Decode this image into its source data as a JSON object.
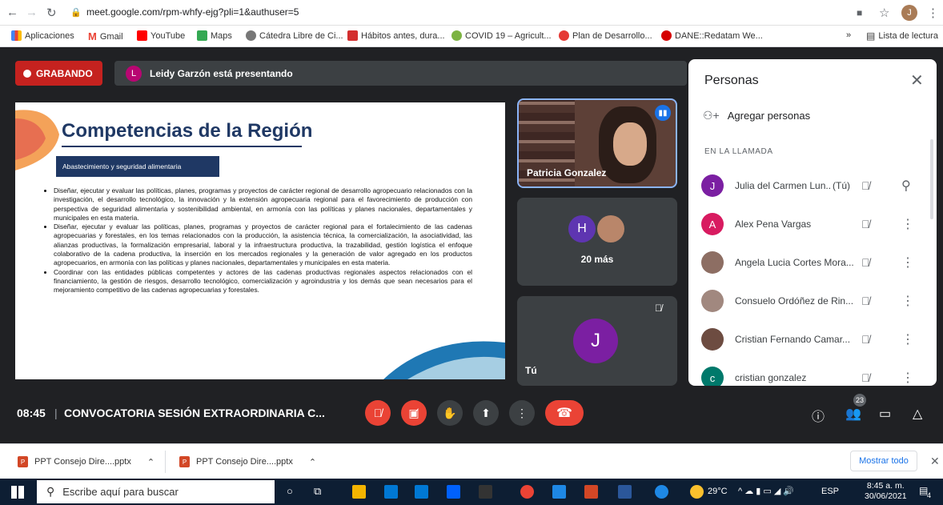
{
  "browser": {
    "url": "meet.google.com/rpm-whfy-ejg?pli=1&authuser=5",
    "profile_initial": "J",
    "bookmarks": [
      "Aplicaciones",
      "Gmail",
      "YouTube",
      "Maps",
      "Cátedra Libre de Ci...",
      "Hábitos antes, dura...",
      "COVID 19 – Agricult...",
      "Plan de Desarrollo...",
      "DANE::Redatam We..."
    ],
    "reading_list": "Lista de lectura"
  },
  "meet": {
    "recording_label": "GRABANDO",
    "presenter_initial": "L",
    "presenting_text": "Leidy Garzón está presentando",
    "slide": {
      "title": "Competencias de la Región",
      "subtitle": "Abastecimiento y seguridad alimentaria",
      "bullets": [
        "Diseñar, ejecutar y evaluar las políticas, planes, programas y proyectos de carácter regional de desarrollo agropecuario relacionados con la investigación, el desarrollo tecnológico, la innovación y la extensión agropecuaria regional para el favorecimiento de producción con perspectiva de seguridad alimentaria y sostenibilidad ambiental, en armonía con las políticas y planes nacionales, departamentales y municipales en esta materia.",
        "Diseñar, ejecutar y evaluar las políticas, planes, programas y proyectos de carácter regional para el fortalecimiento de las cadenas agropecuarias y forestales, en los temas relacionados con la producción, la asistencia técnica, la comercialización, la asociatividad, las alianzas productivas, la formalización empresarial, laboral y la infraestructura productiva, la trazabilidad, gestión logística el enfoque colaborativo de la cadena productiva, la inserción en los mercados regionales y la generación de valor agregado en los productos agropecuarios, en armonía con las políticas y planes nacionales, departamentales y municipales en esta materia.",
        "Coordinar con las entidades públicas competentes y actores de las cadenas productivas regionales aspectos relacionados con el financiamiento, la gestión de riesgos, desarrollo tecnológico, comercialización y agroindustria y los demás que sean necesarios para el mejoramiento competitivo de las cadenas agropecuarias y forestales."
      ]
    },
    "tiles": {
      "speaker_name": "Patricia Gonzalez",
      "more_label": "20 más",
      "more_initial": "H",
      "self_label": "Tú",
      "self_initial": "J"
    },
    "bottom": {
      "time": "08:45",
      "separator": "|",
      "title": "CONVOCATORIA SESIÓN EXTRAORDINARIA C...",
      "participants_count": "23"
    }
  },
  "panel": {
    "title": "Personas",
    "add_people": "Agregar personas",
    "section": "EN LA LLAMADA",
    "people": [
      {
        "initial": "J",
        "name": "Julia del Carmen Lun...",
        "suffix": "(Tú)",
        "color": "#7b1fa2"
      },
      {
        "initial": "A",
        "name": "Alex Pena Vargas",
        "suffix": "",
        "color": "#d81b60"
      },
      {
        "initial": "",
        "name": "Angela Lucia Cortes Mora...",
        "suffix": "",
        "color": "#8d6e63"
      },
      {
        "initial": "",
        "name": "Consuelo Ordóñez de Rin...",
        "suffix": "",
        "color": "#a1887f"
      },
      {
        "initial": "",
        "name": "Cristian Fernando Camar...",
        "suffix": "",
        "color": "#6d4c41"
      },
      {
        "initial": "c",
        "name": "cristian gonzalez",
        "suffix": "",
        "color": "#00796b"
      }
    ]
  },
  "downloads": {
    "files": [
      "PPT Consejo Dire....pptx",
      "PPT Consejo Dire....pptx"
    ],
    "show_all": "Mostrar todo"
  },
  "taskbar": {
    "search_placeholder": "Escribe aquí para buscar",
    "weather": "29°C",
    "language": "ESP",
    "time": "8:45 a. m.",
    "date": "30/06/2021",
    "notifications": "4"
  }
}
